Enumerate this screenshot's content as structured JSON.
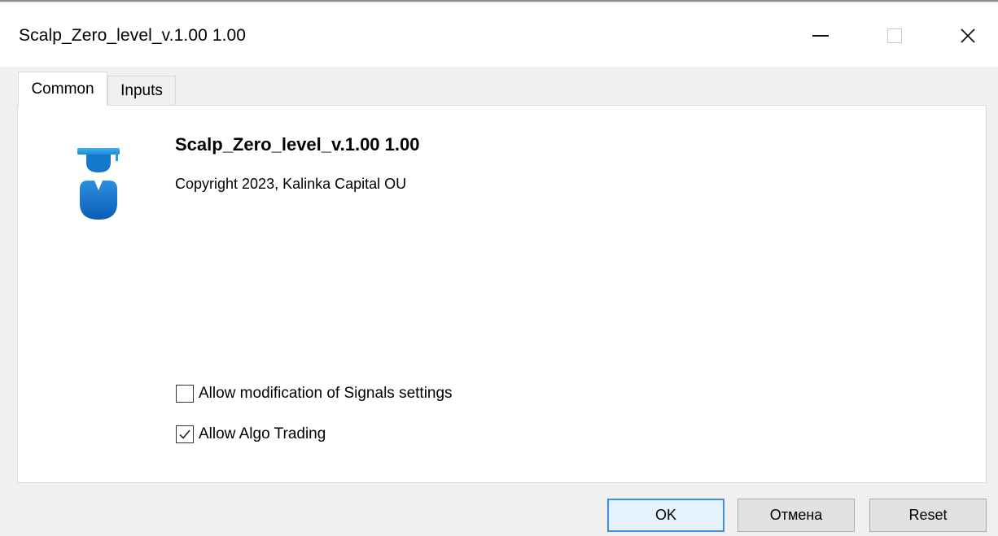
{
  "window": {
    "title": "Scalp_Zero_level_v.1.00 1.00",
    "minimize_icon": "minimize-icon",
    "maximize_icon": "maximize-icon",
    "close_icon": "close-icon",
    "close_glyph": "✕"
  },
  "tabs": [
    {
      "label": "Common",
      "active": true
    },
    {
      "label": "Inputs",
      "active": false
    }
  ],
  "common": {
    "icon": "graduate-icon",
    "icon_color": "#1a73c8",
    "ea_name": "Scalp_Zero_level_v.1.00 1.00",
    "copyright": "Copyright 2023, Kalinka Capital OU",
    "options": [
      {
        "label": "Allow modification of Signals settings",
        "checked": false
      },
      {
        "label": "Allow Algo Trading",
        "checked": true
      }
    ]
  },
  "buttons": {
    "ok": "OK",
    "cancel": "Отмена",
    "reset": "Reset"
  },
  "colors": {
    "ok_border": "#3c8fe0",
    "ok_background": "#e5f1fb"
  }
}
